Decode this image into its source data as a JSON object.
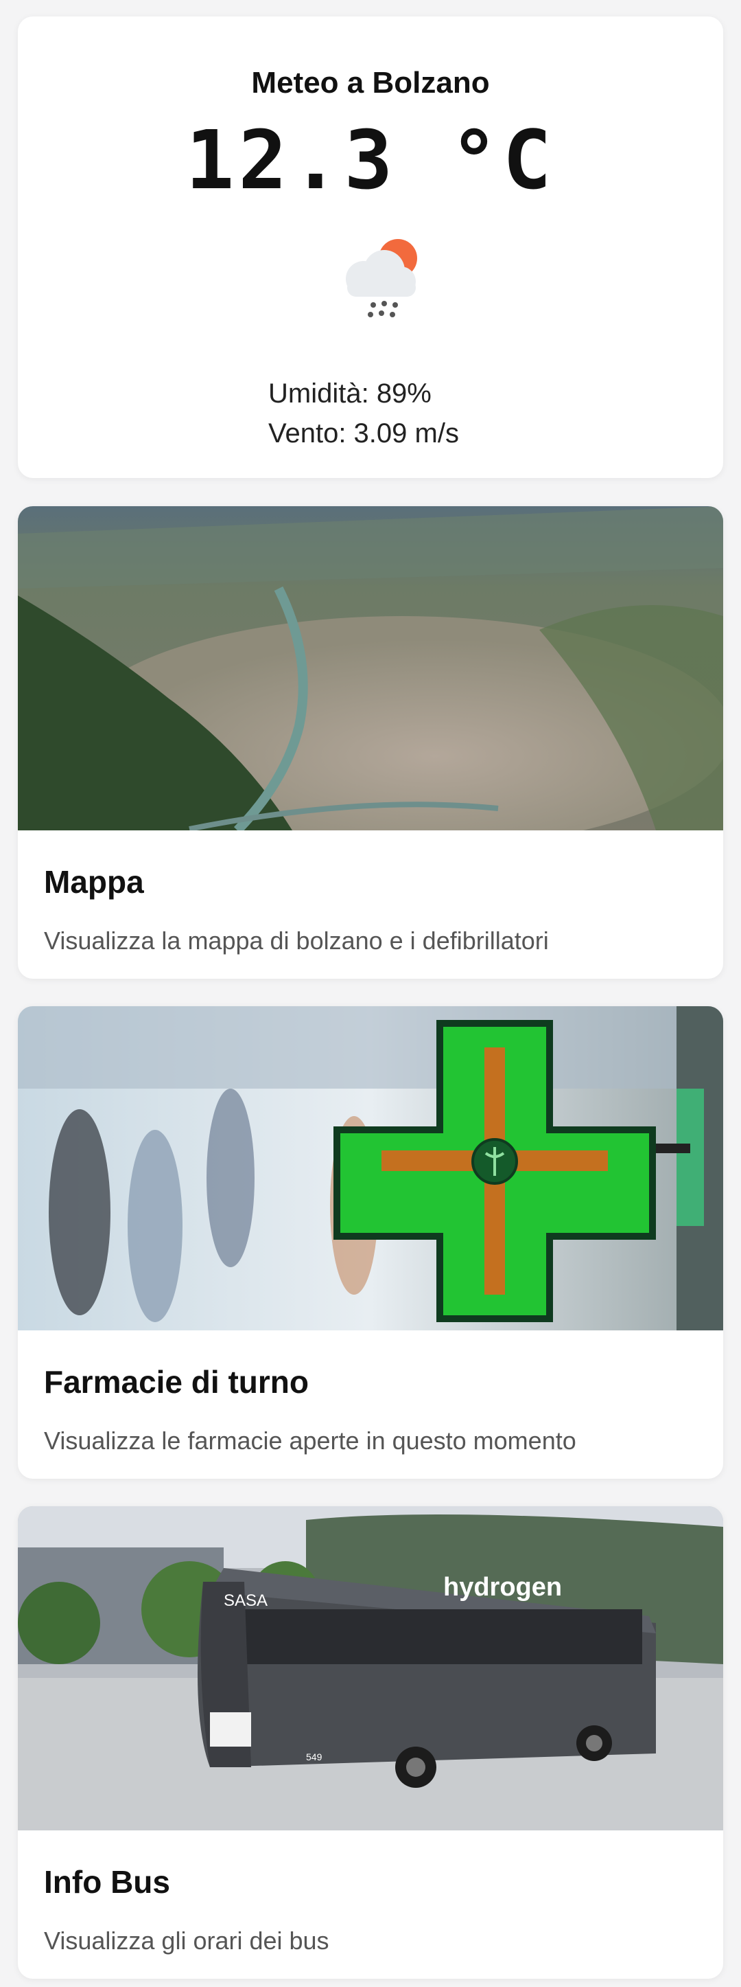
{
  "weather": {
    "title": "Meteo a Bolzano",
    "temperature": "12.3 °C",
    "icon": "cloud-rain-sun-icon",
    "humidity": "Umidità: 89%",
    "wind": "Vento: 3.09 m/s"
  },
  "cards": [
    {
      "title": "Mappa",
      "description": "Visualizza la mappa di bolzano e i defibrillatori",
      "image": "aerial-city-photo"
    },
    {
      "title": "Farmacie di turno",
      "description": "Visualizza le farmacie aperte in questo momento",
      "image": "pharmacy-cross-photo"
    },
    {
      "title": "Info Bus",
      "description": "Visualizza gli orari dei bus",
      "image": "hydrogen-bus-photo"
    }
  ],
  "bus_photo_text": {
    "brand": "hydrogen",
    "operator": "SASA",
    "number": "549"
  },
  "colors": {
    "pharmacy_green": "#22c433",
    "pharmacy_orange": "#e0621c",
    "sun_orange": "#f26a3d"
  }
}
